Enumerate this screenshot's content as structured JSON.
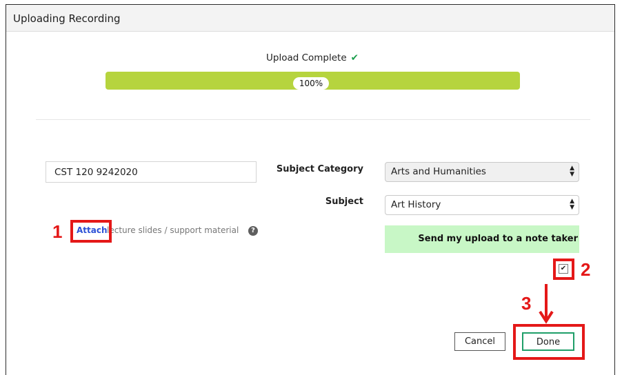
{
  "dialog": {
    "title": "Uploading Recording"
  },
  "upload": {
    "status_text": "Upload Complete",
    "progress_percent": 100,
    "progress_label": "100%"
  },
  "form": {
    "recording_title_value": "CST 120 9242020",
    "subject_category_label": "Subject Category",
    "subject_category_value": "Arts and Humanities",
    "subject_label": "Subject",
    "subject_value": "Art History",
    "attach_link": "Attach",
    "attach_rest": "lecture slides / support material",
    "help_glyph": "?",
    "note_taker_label": "Send my upload to a note taker",
    "note_taker_checked": true
  },
  "buttons": {
    "cancel": "Cancel",
    "done": "Done"
  },
  "annotations": {
    "step1": "1",
    "step2": "2",
    "step3": "3",
    "color": "#e41818"
  },
  "colors": {
    "progress": "#b6d43e",
    "note_taker_bg": "#c8f7c6",
    "done_border": "#1e9e68",
    "link": "#2c51d6"
  }
}
